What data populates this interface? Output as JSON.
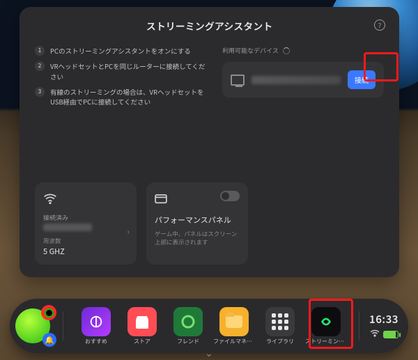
{
  "panel": {
    "title": "ストリーミングアシスタント",
    "help_symbol": "?",
    "steps": [
      "PCのストリーミングアシスタントをオンにする",
      "VRヘッドセットとPCを同じルーターに接続してください",
      "有線のストリーミングの場合は、VRヘッドセットをUSB経由でPCに接続してください"
    ],
    "devices_label": "利用可能なデバイス",
    "connect_label": "接続"
  },
  "wifi_card": {
    "status_label": "接続済み",
    "freq_label": "周波数",
    "freq_value": "5 GHZ"
  },
  "perf_card": {
    "title": "パフォーマンスパネル",
    "desc": "ゲーム中、パネルはスクリーン上部に表示されます"
  },
  "taskbar": {
    "apps": [
      {
        "label": "おすすめ"
      },
      {
        "label": "ストア"
      },
      {
        "label": "フレンド"
      },
      {
        "label": "ファイルマネー…"
      },
      {
        "label": "ライブラリ"
      },
      {
        "label": "ストリーミング…"
      }
    ],
    "time": "16:33",
    "bell_symbol": "🔔"
  }
}
